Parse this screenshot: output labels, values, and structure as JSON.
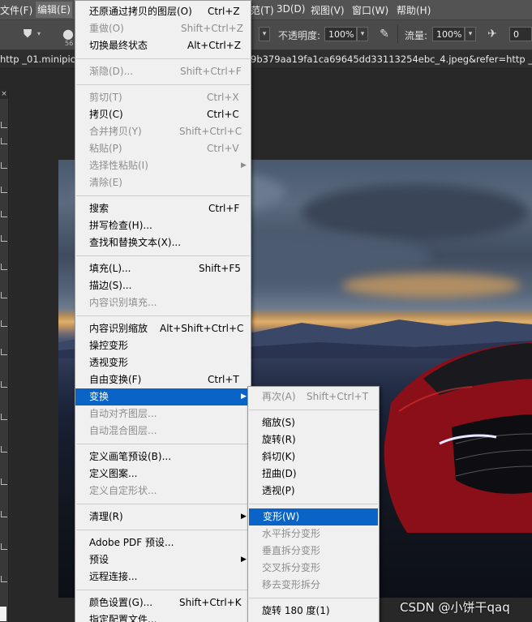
{
  "menubar": {
    "items": [
      {
        "label": "文件(F)"
      },
      {
        "label": "编辑(E)"
      },
      {
        "label": "范(T)"
      },
      {
        "label": "3D(D)"
      },
      {
        "label": "视图(V)"
      },
      {
        "label": "窗口(W)"
      },
      {
        "label": "帮助(H)"
      }
    ]
  },
  "options": {
    "brush_size": "56",
    "opacity_label": "不透明度:",
    "opacity_value": "100%",
    "flow_label": "流量:",
    "flow_value": "100%",
    "angle_value": "0"
  },
  "tab": {
    "left_text": "http _01.minipic.e",
    "right_text": "9b379aa19fa1ca69645dd33113254ebc_4.jpeg&refer=http _01.minipi"
  },
  "edit_menu": {
    "items": [
      {
        "label": "还原通过拷贝的图层(O)",
        "shortcut": "Ctrl+Z",
        "disabled": false
      },
      {
        "label": "重做(O)",
        "shortcut": "Shift+Ctrl+Z",
        "disabled": true
      },
      {
        "label": "切换最终状态",
        "shortcut": "Alt+Ctrl+Z",
        "disabled": false
      },
      {
        "label": "渐隐(D)...",
        "shortcut": "Shift+Ctrl+F",
        "disabled": true
      },
      {
        "label": "剪切(T)",
        "shortcut": "Ctrl+X",
        "disabled": true
      },
      {
        "label": "拷贝(C)",
        "shortcut": "Ctrl+C",
        "disabled": false
      },
      {
        "label": "合并拷贝(Y)",
        "shortcut": "Shift+Ctrl+C",
        "disabled": true
      },
      {
        "label": "粘贴(P)",
        "shortcut": "Ctrl+V",
        "disabled": true
      },
      {
        "label": "选择性粘贴(I)",
        "shortcut": "",
        "disabled": true
      },
      {
        "label": "清除(E)",
        "shortcut": "",
        "disabled": true
      },
      {
        "label": "搜索",
        "shortcut": "Ctrl+F",
        "disabled": false
      },
      {
        "label": "拼写检查(H)...",
        "shortcut": "",
        "disabled": false
      },
      {
        "label": "查找和替换文本(X)...",
        "shortcut": "",
        "disabled": false
      },
      {
        "label": "填充(L)...",
        "shortcut": "Shift+F5",
        "disabled": false
      },
      {
        "label": "描边(S)...",
        "shortcut": "",
        "disabled": false
      },
      {
        "label": "内容识别填充...",
        "shortcut": "",
        "disabled": true
      },
      {
        "label": "内容识别缩放",
        "shortcut": "Alt+Shift+Ctrl+C",
        "disabled": false
      },
      {
        "label": "操控变形",
        "shortcut": "",
        "disabled": false
      },
      {
        "label": "透视变形",
        "shortcut": "",
        "disabled": false
      },
      {
        "label": "自由变换(F)",
        "shortcut": "Ctrl+T",
        "disabled": false
      },
      {
        "label": "变换",
        "shortcut": "",
        "disabled": false
      },
      {
        "label": "自动对齐图层...",
        "shortcut": "",
        "disabled": true
      },
      {
        "label": "自动混合图层...",
        "shortcut": "",
        "disabled": true
      },
      {
        "label": "定义画笔预设(B)...",
        "shortcut": "",
        "disabled": false
      },
      {
        "label": "定义图案...",
        "shortcut": "",
        "disabled": false
      },
      {
        "label": "定义自定形状...",
        "shortcut": "",
        "disabled": true
      },
      {
        "label": "清理(R)",
        "shortcut": "",
        "disabled": false
      },
      {
        "label": "Adobe PDF 预设...",
        "shortcut": "",
        "disabled": false
      },
      {
        "label": "预设",
        "shortcut": "",
        "disabled": false
      },
      {
        "label": "远程连接...",
        "shortcut": "",
        "disabled": false
      },
      {
        "label": "颜色设置(G)...",
        "shortcut": "Shift+Ctrl+K",
        "disabled": false
      },
      {
        "label": "指定配置文件...",
        "shortcut": "",
        "disabled": false
      }
    ]
  },
  "transform_menu": {
    "items": [
      {
        "label": "再次(A)",
        "shortcut": "Shift+Ctrl+T",
        "disabled": true
      },
      {
        "label": "缩放(S)",
        "shortcut": "",
        "disabled": false
      },
      {
        "label": "旋转(R)",
        "shortcut": "",
        "disabled": false
      },
      {
        "label": "斜切(K)",
        "shortcut": "",
        "disabled": false
      },
      {
        "label": "扭曲(D)",
        "shortcut": "",
        "disabled": false
      },
      {
        "label": "透视(P)",
        "shortcut": "",
        "disabled": false
      },
      {
        "label": "变形(W)",
        "shortcut": "",
        "disabled": false
      },
      {
        "label": "水平拆分变形",
        "shortcut": "",
        "disabled": true
      },
      {
        "label": "垂直拆分变形",
        "shortcut": "",
        "disabled": true
      },
      {
        "label": "交叉拆分变形",
        "shortcut": "",
        "disabled": true
      },
      {
        "label": "移去变形拆分",
        "shortcut": "",
        "disabled": true
      },
      {
        "label": "旋转 180 度(1)",
        "shortcut": "",
        "disabled": false
      }
    ]
  },
  "watermark": "CSDN @小饼干qaq",
  "colors": {
    "highlight": "#0a64c8",
    "menu_bg": "#f0f0f0",
    "disabled_text": "#8d8d8d"
  }
}
